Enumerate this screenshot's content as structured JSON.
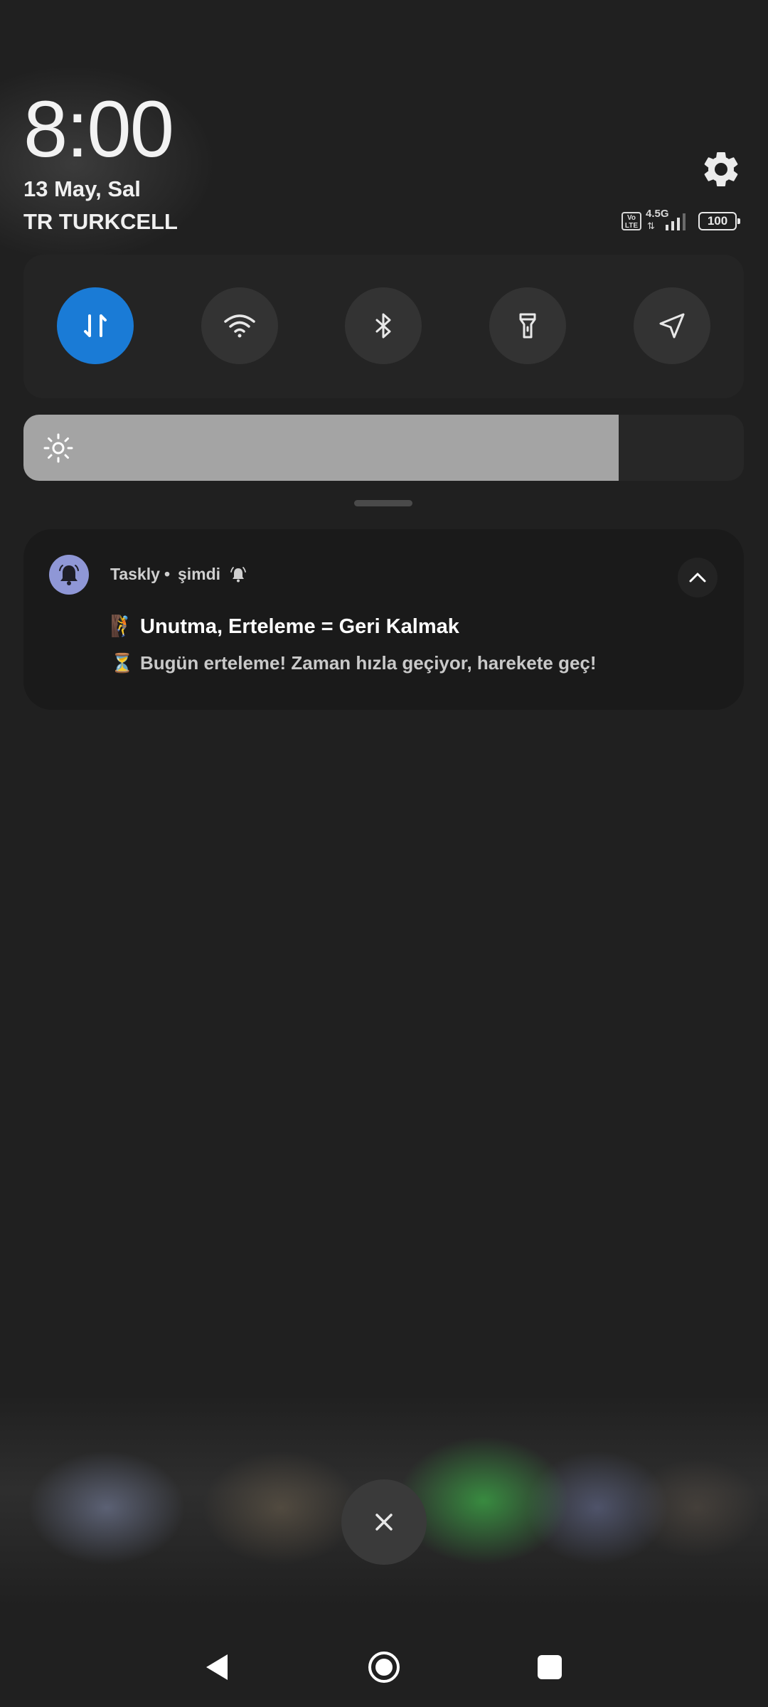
{
  "header": {
    "time": "8:00",
    "date": "13 May, Sal",
    "carrier": "TR TURKCELL"
  },
  "status": {
    "volte": "Vo LTE",
    "network_type": "4.5G",
    "network_arrows": "⇅",
    "battery": "100",
    "signal_icon": "signal-bars-icon"
  },
  "quick_settings": {
    "tiles": [
      {
        "name": "mobile-data",
        "icon": "data-transfer-icon",
        "active": true
      },
      {
        "name": "wifi",
        "icon": "wifi-icon",
        "active": false
      },
      {
        "name": "bluetooth",
        "icon": "bluetooth-icon",
        "active": false
      },
      {
        "name": "flashlight",
        "icon": "flashlight-icon",
        "active": false
      },
      {
        "name": "location",
        "icon": "location-arrow-icon",
        "active": false
      }
    ],
    "active_color": "#1a7bd6",
    "brightness_level": 0.826
  },
  "notification": {
    "app_name": "Taskly",
    "separator": "•",
    "time": "şimdi",
    "title_emoji": "🧗",
    "title": "Unutma, Erteleme = Geri Kalmak",
    "body_emoji": "⏳",
    "body": "Bugün erteleme! Zaman hızla geçiyor, harekete geç!",
    "app_icon_color": "#8f97d6"
  }
}
